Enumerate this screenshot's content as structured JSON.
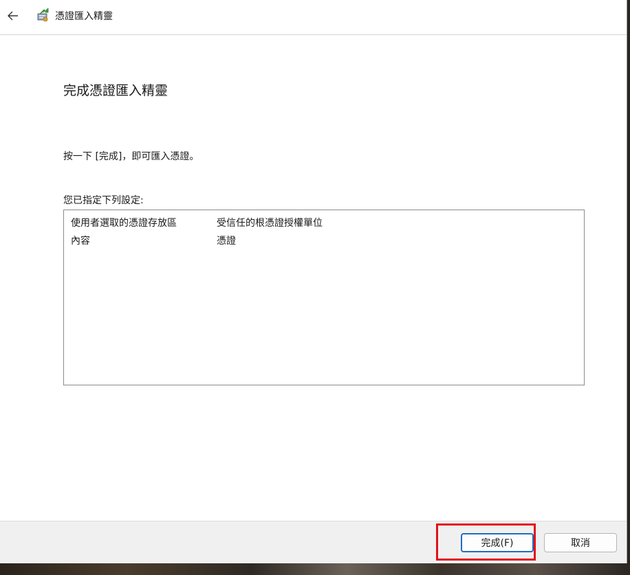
{
  "window": {
    "title": "憑證匯入精靈",
    "back_icon": "back-arrow-icon",
    "app_icon": "certificate-import-icon"
  },
  "page": {
    "heading": "完成憑證匯入精靈",
    "instruction": "按一下 [完成]，即可匯入憑證。",
    "settings_label": "您已指定下列設定:",
    "settings": [
      {
        "key": "使用者選取的憑證存放區",
        "value": "受信任的根憑證授權單位"
      },
      {
        "key": "內容",
        "value": "憑證"
      }
    ]
  },
  "footer": {
    "finish_label": "完成(F)",
    "cancel_label": "取消"
  },
  "colors": {
    "highlight": "#e3101a",
    "default_button_border": "#1a6fc2"
  }
}
